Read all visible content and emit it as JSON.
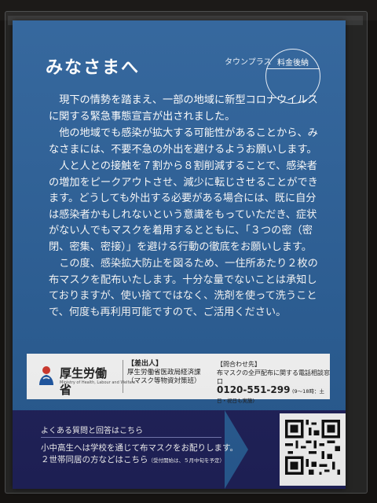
{
  "card": {
    "title": "みなさまへ",
    "publisher": "タウンプラス",
    "postage_mark": "料金後納",
    "paragraphs": [
      "現下の情勢を踏まえ、一部の地域に新型コロナウイルスに関する緊急事態宣言が出されました。",
      "他の地域でも感染が拡大する可能性があることから、みなさまには、不要不急の外出を避けるようお願いします。",
      "人と人との接触を７割から８割削減することで、感染者の増加をピークアウトさせ、減少に転じさせることができます。どうしても外出する必要がある場合には、既に自分は感染者かもしれないという意識をもっていただき、症状がない人でもマスクを着用するとともに、「３つの密（密閉、密集、密接）」を避ける行動の徹底をお願いします。",
      "この度、感染拡大防止を図るため、一住所あたり２枚の布マスクを配布いたします。十分な量でないことは承知しておりますが、使い捨てではなく、洗剤を使って洗うことで、何度も再利用可能ですので、ご活用ください。"
    ],
    "footer": {
      "ministry_name": "厚生労働省",
      "ministry_en": "Ministry of Health, Labour and Welfare",
      "sender_heading": "【差出人】",
      "sender_name": "厚生労働省医政局経済課",
      "sender_sub": "（マスク等物資対策班）",
      "contact_heading": "【問合わせ先】",
      "contact_desc": "布マスクの全戸配布に関する電話相談窓口",
      "phone": "0120-551-299",
      "hours": "(9～18時：土日・祝日も実施)"
    },
    "bottom": {
      "faq_label": "よくある質問と回答はこちら",
      "line1": "小中高生へは学校を通じて布マスクをお配りします。",
      "line2": "２世帯同居の方などはこちら",
      "line2_note": "（受付開始は、５月中旬を予定）"
    }
  },
  "colors": {
    "card_blue": "#2a5f98",
    "band_navy": "#20225c",
    "logo_red": "#d83a2e",
    "logo_blue": "#1f5aa8"
  },
  "icons": [
    "ministry-logo-icon",
    "qr-code-icon"
  ]
}
